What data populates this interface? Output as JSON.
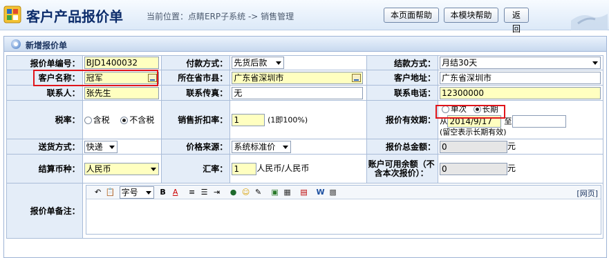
{
  "header": {
    "title": "客户产品报价单",
    "location": "当前位置：点睛ERP子系统 -> 销售管理",
    "buttons": {
      "page_help": "本页面帮助",
      "module_help": "本模块帮助",
      "back": "返回"
    }
  },
  "panel": {
    "title": "新增报价单"
  },
  "form": {
    "quote_no": {
      "label": "报价单编号：",
      "value": "BJD1400032"
    },
    "payment_method": {
      "label": "付款方式：",
      "value": "先货后款"
    },
    "settlement_method": {
      "label": "结款方式：",
      "value": "月结30天"
    },
    "customer_name": {
      "label": "客户名称：",
      "value": "冠军"
    },
    "province_city": {
      "label": "所在省市县：",
      "value": "广东省深圳市"
    },
    "customer_address": {
      "label": "客户地址：",
      "value": "广东省深圳市"
    },
    "contact": {
      "label": "联系人：",
      "value": "张先生"
    },
    "fax": {
      "label": "联系传真：",
      "value": "无"
    },
    "phone": {
      "label": "联系电话：",
      "value": "12300000"
    },
    "tax": {
      "label": "税率：",
      "option_incl": "含税",
      "option_excl": "不含税",
      "selected": "不含税"
    },
    "discount": {
      "label": "销售折扣率：",
      "value": "1",
      "hint": "(1即100%)"
    },
    "validity": {
      "label": "报价有效期：",
      "option_once": "单次",
      "option_long": "长期",
      "selected": "长期",
      "from_label": "从",
      "from_value": "2014/9/17",
      "to_label": "至",
      "to_value": "",
      "hint": "(留空表示长期有效)"
    },
    "delivery": {
      "label": "送货方式：",
      "value": "快递"
    },
    "price_source": {
      "label": "价格来源：",
      "value": "系统标准价"
    },
    "total": {
      "label": "报价总金额：",
      "value": "0",
      "unit": "元"
    },
    "currency": {
      "label": "结算币种：",
      "value": "人民币"
    },
    "exchange_rate": {
      "label": "汇率：",
      "value": "1",
      "unit": "人民币/人民币"
    },
    "available_balance": {
      "label": "账户可用余额（不含本次报价）：",
      "value": "0",
      "unit": "元"
    },
    "remarks": {
      "label": "报价单备注：",
      "font_size_label": "字号",
      "web_label": "[网页]"
    }
  }
}
